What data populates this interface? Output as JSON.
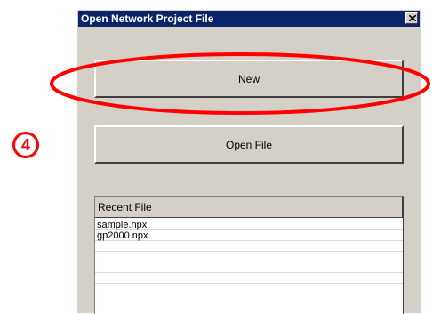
{
  "window": {
    "title": "Open Network Project File",
    "close_icon": "close-x-icon"
  },
  "buttons": {
    "new_label": "New",
    "open_file_label": "Open File"
  },
  "recent_files": {
    "header": "Recent File",
    "items": [
      "sample.npx",
      "gp2000.npx",
      "",
      "",
      "",
      "",
      ""
    ]
  },
  "annotations": {
    "step_marker": "4",
    "highlight_color": "#ff0000"
  },
  "colors": {
    "titlebar": "#0a246a",
    "dialog_face": "#d4d0c8",
    "annotation": "#ff0000"
  }
}
